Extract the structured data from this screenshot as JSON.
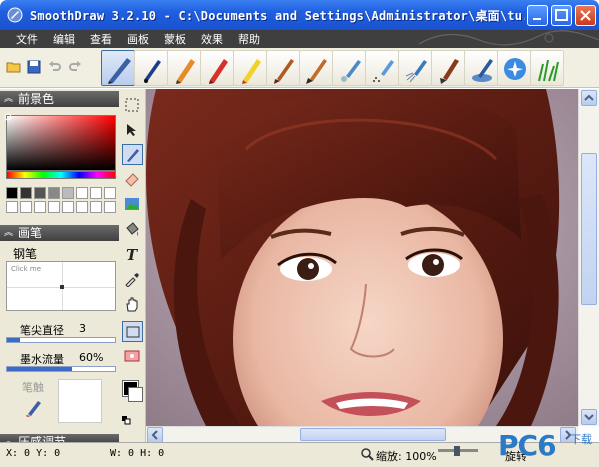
{
  "window": {
    "title": "SmoothDraw 3.2.10 - C:\\Documents and Settings\\Administrator\\桌面\\tu..."
  },
  "menu": [
    "文件",
    "编辑",
    "查看",
    "画板",
    "蒙板",
    "效果",
    "帮助"
  ],
  "toolbar": {
    "small_icons": [
      "open-folder-icon",
      "save-icon",
      "undo-icon",
      "redo-icon"
    ],
    "brushes": [
      "pen",
      "ink-pen",
      "pencil",
      "marker",
      "crayon",
      "brush",
      "paintbrush",
      "airbrush",
      "spray",
      "sprinkle",
      "flat-brush",
      "water-brush",
      "glitter",
      "grass"
    ]
  },
  "left_panel": {
    "foreground_header": "前景色",
    "brush_header": "画笔",
    "brush_name": "钢笔",
    "preview_label": "Click me",
    "tip_diameter_label": "笔尖直径",
    "tip_diameter_value": "3",
    "tip_diameter_fraction": 0.12,
    "ink_flow_label": "墨水流量",
    "ink_flow_value": "60%",
    "ink_flow_fraction": 0.6,
    "nib_label": "笔触",
    "bottom_header": "压感调节"
  },
  "tools": [
    "select-rect",
    "move",
    "brush",
    "eraser",
    "image",
    "fill",
    "text",
    "eyedropper",
    "hand",
    "rectangle",
    "ellipse"
  ],
  "status": {
    "xy": "X: 0 Y: 0",
    "wh": "W: 0 H: 0",
    "zoom_label": "缩放: 100%",
    "rotate_label": "旋转"
  },
  "watermark": {
    "brand": "PC6",
    "sub": "下载"
  },
  "colors": {
    "title_blue": "#1f5fe0",
    "menubar": "#3f3f3f",
    "panel_header": "#404040"
  }
}
